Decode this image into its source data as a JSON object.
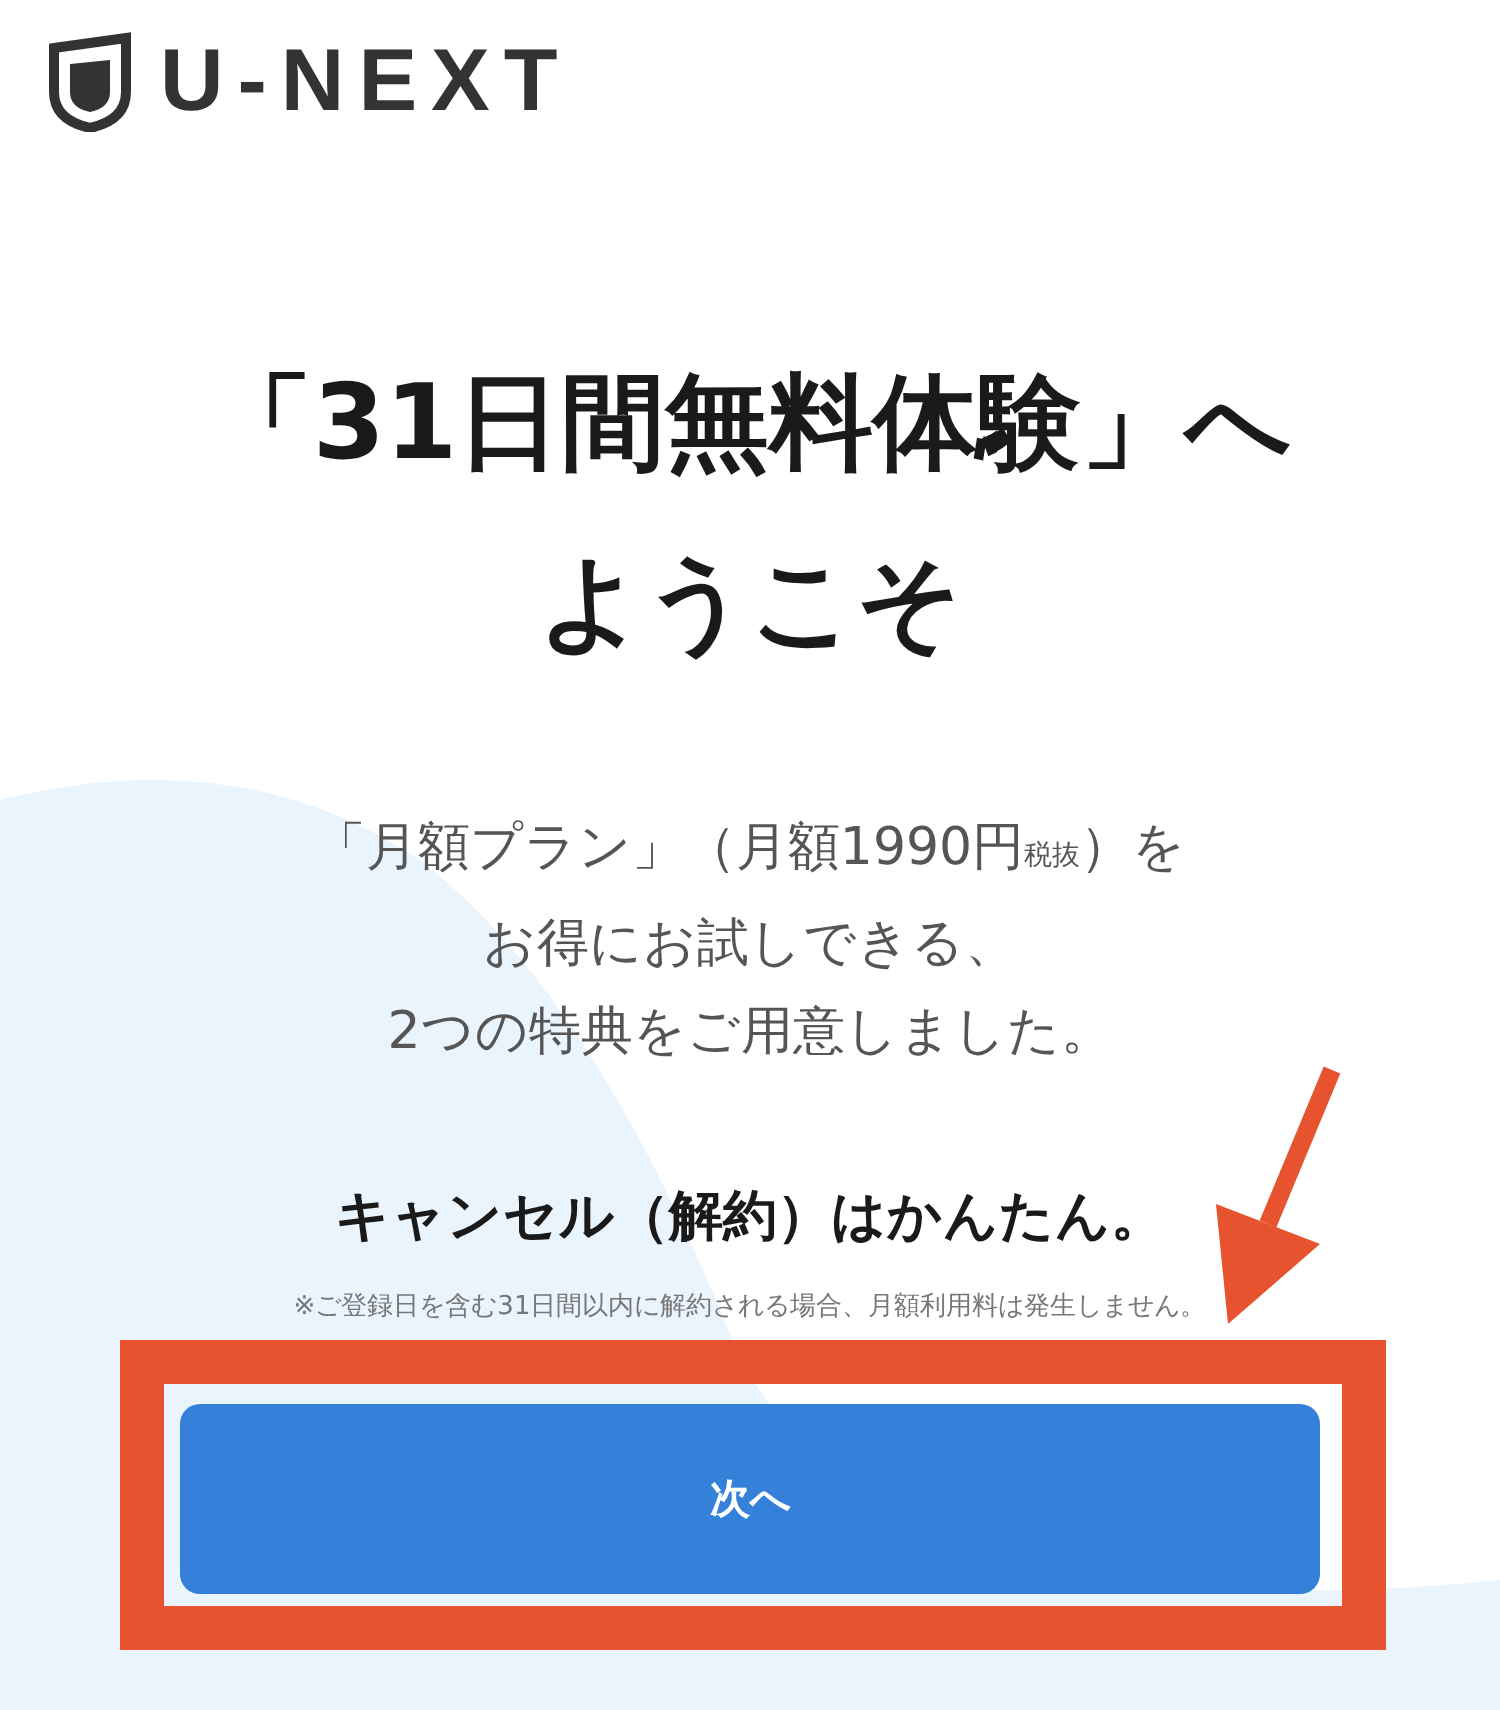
{
  "logo": {
    "text": "U-NEXT"
  },
  "title": [
    "「31日間無料体験」へ",
    "ようこそ"
  ],
  "intro": [
    "「月額プラン」（月額1990円$_{税抜}$）を",
    "お得にお試しできる、",
    "2つの特典をご用意しました。"
  ],
  "cancel_note": "キャンセル（解約）はかんたん。",
  "footnote": "※ご登録日を含む31日間以内に解約される場合、月額利用料は発生しません。",
  "next_button": {
    "label": "次へ"
  }
}
